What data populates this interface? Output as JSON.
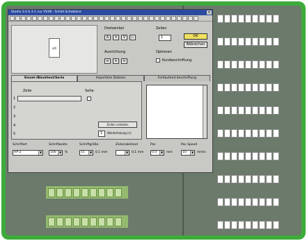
{
  "window": {
    "title": "Studio 3.0 b 3.1 nur VV48 - Schild Schablone",
    "close_glyph": "×"
  },
  "preview": {
    "chip_label": "s/4"
  },
  "alignment": {
    "label": "Drehwinkel",
    "buttons": [
      "A",
      "∢",
      "V",
      "▷"
    ]
  },
  "columns": {
    "label": "Zeilen",
    "value": "1"
  },
  "ok_label": "OK",
  "cancel_label": "Abbrechen",
  "orientation": {
    "label": "Ausrichtung",
    "buttons": [
      "≡",
      "≡",
      "≡"
    ]
  },
  "options": {
    "label": "Optionen",
    "checkbox_label": "Kurzbeschriftung"
  },
  "tabs": [
    "Einzel-/Blocktext/Serie",
    "Importiere Dateien",
    "Fortlaufend beschriftung"
  ],
  "text_tab": {
    "zeile_label": "Zeile",
    "seite_label": "Seite",
    "row_numbers": [
      "1",
      "2",
      "3",
      "4",
      "5"
    ],
    "apply_button": "Zeilen erstellen",
    "repeat_value": "1",
    "repeat_label": "Wiederholung (n)"
  },
  "bottom": {
    "schriftart": {
      "label": "Schriftart",
      "value": "HP-2"
    },
    "schriftweite": {
      "label": "Schriftweite",
      "value": "100",
      "unit": "%"
    },
    "schriftgroesse": {
      "label": "Schriftgröße",
      "value": "15",
      "unit": "0,1 mm"
    },
    "zeilenabstand": {
      "label": "Zeilenabstand",
      "value": "",
      "unit": "0,1 mm"
    },
    "pos": {
      "label": "Pos",
      "value": "0.0",
      "unit": "mm"
    },
    "pos_speed": {
      "label": "Pos Speed",
      "value": "10",
      "unit": "mm/s"
    }
  }
}
